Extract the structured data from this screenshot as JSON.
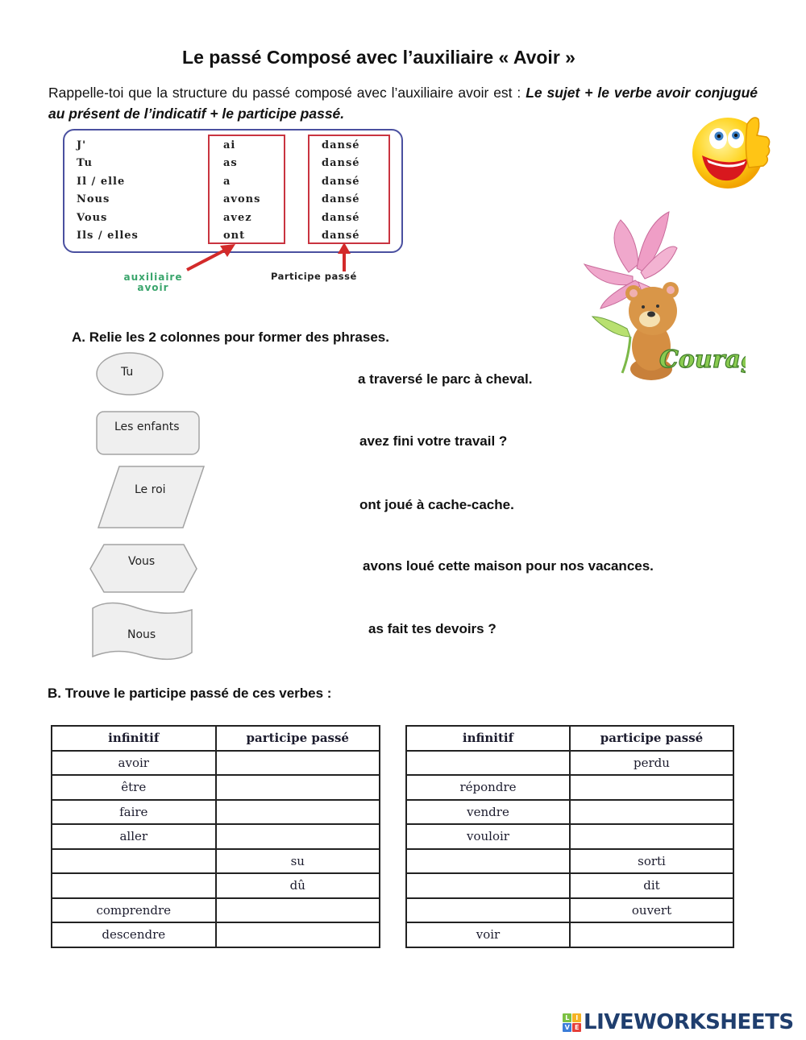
{
  "title": "Le passé Composé avec l’auxiliaire « Avoir »",
  "intro": {
    "plain": "Rappelle-toi  que la structure du passé composé avec l’auxiliaire  avoir est : ",
    "bold": "Le sujet + le verbe avoir conjugué au présent de l’indicatif + le participe passé."
  },
  "conjugation": {
    "subjects": [
      "J'",
      "Tu",
      "Il / elle",
      "Nous",
      "Vous",
      "Ils / elles"
    ],
    "auxiliary": [
      "ai",
      "as",
      "a",
      "avons",
      "avez",
      "ont"
    ],
    "participle": [
      "dansé",
      "dansé",
      "dansé",
      "dansé",
      "dansé",
      "dansé"
    ],
    "label_aux_line1": "auxiliaire",
    "label_aux_line2": "avoir",
    "label_participle": "Participe passé",
    "colors": {
      "frame": "#4a50a0",
      "highlight": "#c93440",
      "aux_label": "#3aa56c"
    }
  },
  "images": {
    "smiley": "thumbs-up smiley",
    "bear_caption": "Courage"
  },
  "section_a": {
    "heading": "A.  Relie les 2 colonnes pour former des phrases.",
    "subjects": [
      "Tu",
      "Les enfants",
      "Le roi",
      "Vous",
      "Nous"
    ],
    "endings": [
      "a traversé  le parc à cheval.",
      "avez fini votre travail ?",
      "ont joué à cache-cache.",
      "avons loué cette maison  pour nos vacances.",
      "as fait tes devoirs ?"
    ]
  },
  "section_b": {
    "heading": "B. Trouve le participe passé de ces verbes :",
    "headers": [
      "infinitif",
      "participe passé"
    ],
    "table_left": [
      [
        "avoir",
        ""
      ],
      [
        "être",
        ""
      ],
      [
        "faire",
        ""
      ],
      [
        "aller",
        ""
      ],
      [
        "",
        "su"
      ],
      [
        "",
        "dû"
      ],
      [
        "comprendre",
        ""
      ],
      [
        "descendre",
        ""
      ]
    ],
    "table_right": [
      [
        "",
        "perdu"
      ],
      [
        "répondre",
        ""
      ],
      [
        "vendre",
        ""
      ],
      [
        "vouloir",
        ""
      ],
      [
        "",
        "sorti"
      ],
      [
        "",
        "dit"
      ],
      [
        "",
        "ouvert"
      ],
      [
        "voir",
        ""
      ]
    ]
  },
  "footer": {
    "logo_text": "LIVEWORKSHEETS",
    "logo_letters": [
      "L",
      "I",
      "V",
      "E"
    ],
    "logo_colors": [
      "#7cc142",
      "#f5b324",
      "#3b7dd8",
      "#e5403a"
    ],
    "brand_color": "#1f3e6e"
  }
}
